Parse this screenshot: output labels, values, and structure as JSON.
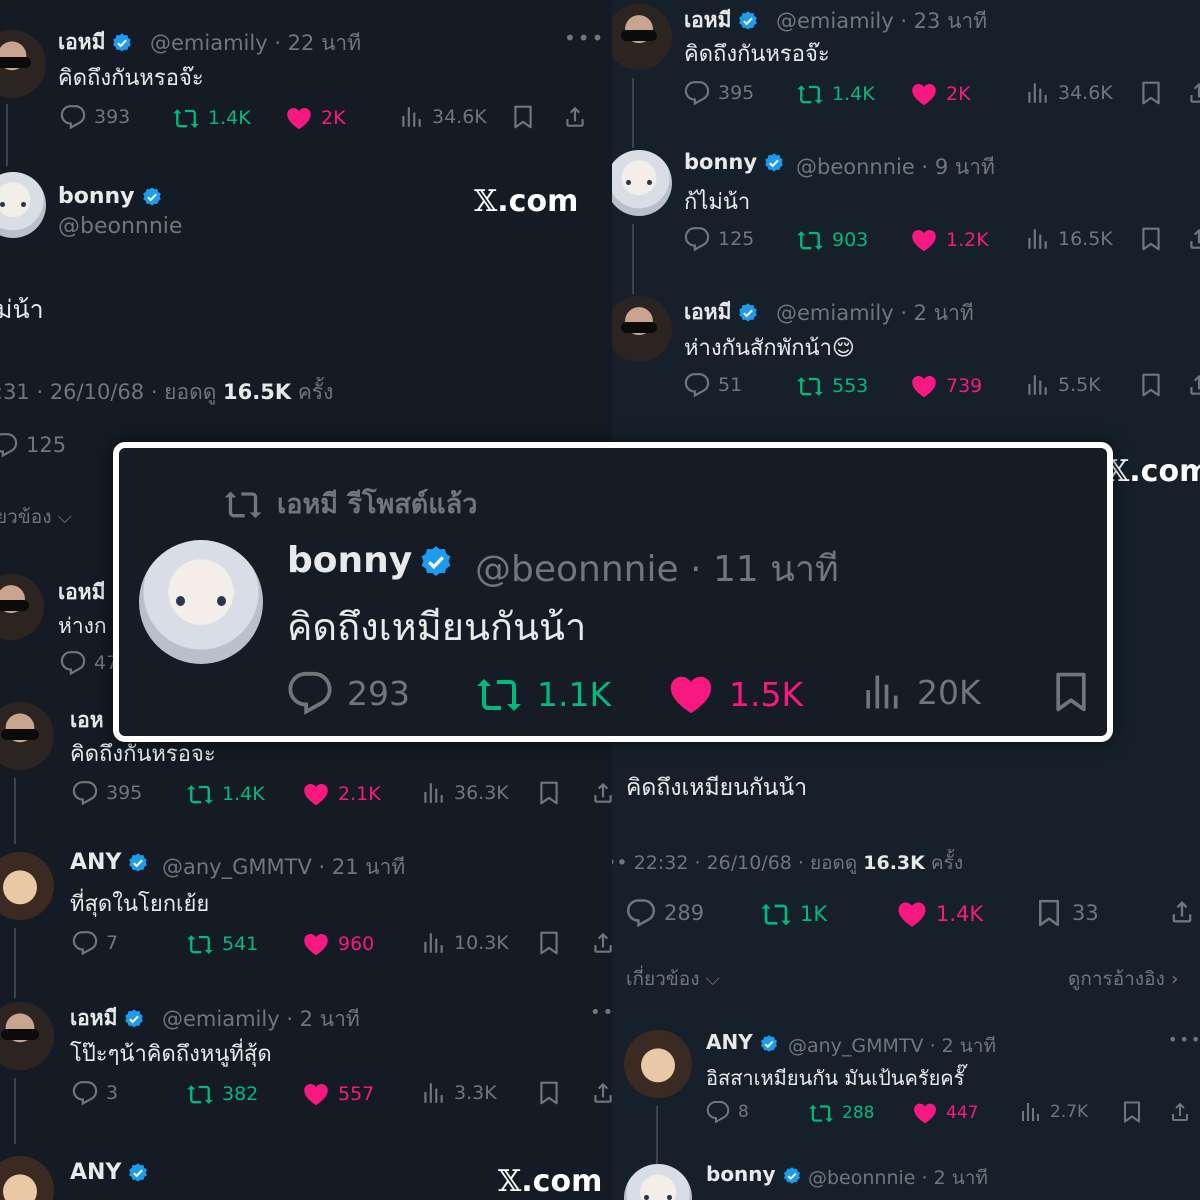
{
  "colors": {
    "background": "#16202b",
    "text": "#e7e9ea",
    "muted": "#71767b",
    "retweet": "#00ba7c",
    "like": "#f91880",
    "verified": "#1d9bf0"
  },
  "left": {
    "t1": {
      "name": "เอหมี",
      "handle": "@emiamily",
      "time": "22 นาที",
      "text": "คิดถึงกันหรอจ๊ะ",
      "replies": "393",
      "reposts": "1.4K",
      "likes": "2K",
      "views": "34.6K"
    },
    "main": {
      "name": "bonny",
      "handle": "@beonnnie",
      "watermark": ".com",
      "text": "ม่น้า",
      "time_prefix": ":31 · 26/10/68 · ยอดดู ",
      "views": "16.5K",
      "views_suffix": " ครั้ง",
      "replies": "125",
      "related": "ยวข้อง"
    },
    "t2": {
      "name": "เอหมี",
      "text": "ห่างก"
    },
    "t2_reply": "47",
    "t3": {
      "name": "เอห",
      "text": "คิดถึงกันหรอจะ",
      "replies": "395",
      "reposts": "1.4K",
      "likes": "2.1K",
      "views": "36.3K"
    },
    "t4": {
      "name": "ANY",
      "handle": "@any_GMMTV",
      "time": "21 นาที",
      "text": "ที่สุดในโยกเย้ย",
      "replies": "7",
      "reposts": "541",
      "likes": "960",
      "views": "10.3K"
    },
    "t5": {
      "name": "เอหมี",
      "handle": "@emiamily",
      "time": "2 นาที",
      "text": "โป๊ะๆน้าคิดถึงหนูที่สุ้ด",
      "replies": "3",
      "reposts": "382",
      "likes": "557",
      "views": "3.3K"
    },
    "t6": {
      "name": "ANY",
      "watermark": ".com"
    }
  },
  "right": {
    "r1": {
      "name": "เอหมี",
      "handle": "@emiamily",
      "time": "23 นาที",
      "text": "คิดถึงกันหรอจ๊ะ",
      "replies": "395",
      "reposts": "1.4K",
      "likes": "2K",
      "views": "34.6K"
    },
    "r2": {
      "name": "bonny",
      "handle": "@beonnnie",
      "time": "9 นาที",
      "text": "ก้ไม่น้า",
      "replies": "125",
      "reposts": "903",
      "likes": "1.2K",
      "views": "16.5K"
    },
    "r3": {
      "name": "เอหมี",
      "handle": "@emiamily",
      "time": "2 นาที",
      "text": "ห่างกันสักพักน้า😌",
      "replies": "51",
      "reposts": "553",
      "likes": "739",
      "views": "5.5K"
    },
    "watermark": ".com",
    "main": {
      "text": "คิดถึงเหมียนกันน้า",
      "time_prefix": "22:32 · 26/10/68 · ยอดดู ",
      "views": "16.3K",
      "views_suffix": " ครั้ง",
      "replies": "289",
      "reposts": "1K",
      "likes": "1.4K",
      "bookmarks": "33",
      "related": "เกี่ยวข้อง",
      "quotes": "ดูการอ้างอิง"
    },
    "r4": {
      "name": "ANY",
      "handle": "@any_GMMTV",
      "time": "2 นาที",
      "text": "อิสสาเหมียนกัน มันเป้นครัยครั๊",
      "replies": "8",
      "reposts": "288",
      "likes": "447",
      "views": "2.7K"
    },
    "r5": {
      "name": "bonny",
      "handle": "@beonnnie",
      "time": "2 นาที"
    }
  },
  "card": {
    "repost_label": "เอหมี รีโพสต์แล้ว",
    "name": "bonny",
    "handle": "@beonnnie",
    "time": "11 นาที",
    "text": "คิดถึงเหมียนกันน้า",
    "replies": "293",
    "reposts": "1.1K",
    "likes": "1.5K",
    "views": "20K"
  },
  "icons": [
    "reply-icon",
    "repost-icon",
    "like-icon",
    "views-icon",
    "bookmark-icon",
    "share-icon",
    "verified-badge-icon",
    "more-icon",
    "chevron-down-icon",
    "chevron-right-icon"
  ]
}
